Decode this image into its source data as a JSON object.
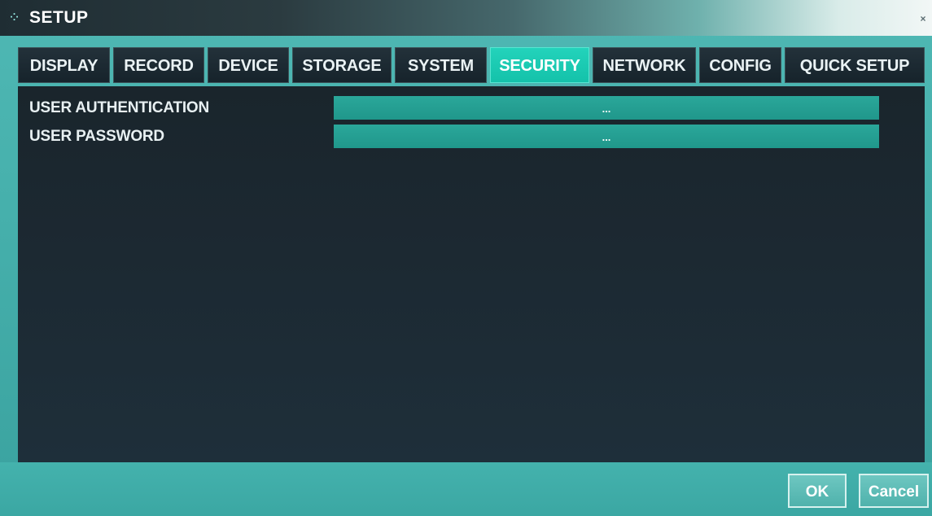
{
  "window": {
    "title": "SETUP",
    "icon": "setup-icon",
    "close_glyph": "×"
  },
  "tabs": [
    {
      "label": "DISPLAY",
      "active": false
    },
    {
      "label": "RECORD",
      "active": false
    },
    {
      "label": "DEVICE",
      "active": false
    },
    {
      "label": "STORAGE",
      "active": false
    },
    {
      "label": "SYSTEM",
      "active": false
    },
    {
      "label": "SECURITY",
      "active": true
    },
    {
      "label": "NETWORK",
      "active": false
    },
    {
      "label": "CONFIG",
      "active": false
    },
    {
      "label": "QUICK SETUP",
      "active": false
    }
  ],
  "settings": [
    {
      "label": "USER AUTHENTICATION",
      "value": "..."
    },
    {
      "label": "USER PASSWORD",
      "value": "..."
    }
  ],
  "footer": {
    "ok_label": "OK",
    "cancel_label": "Cancel"
  },
  "colors": {
    "accent": "#14c2aa",
    "panel": "#1c2932",
    "frame": "#46b0ac",
    "field": "#20978b"
  }
}
